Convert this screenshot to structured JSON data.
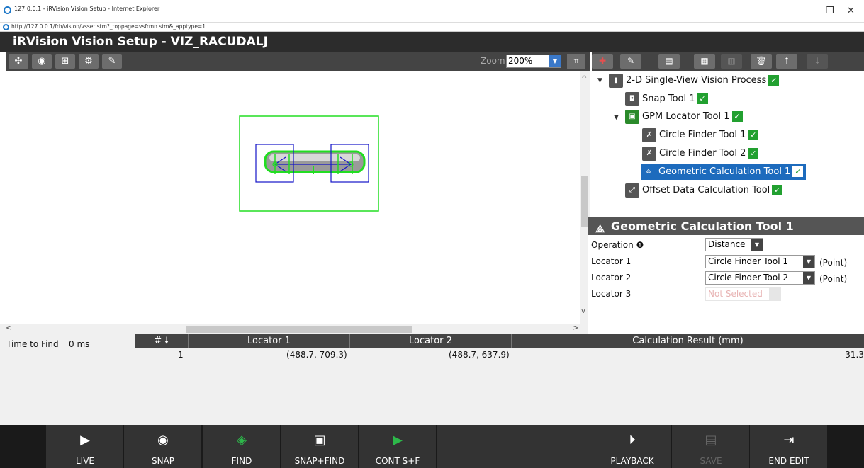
{
  "browser": {
    "title": "127.0.0.1 - iRVision Vision Setup - Internet Explorer",
    "url": "http://127.0.0.1/frh/vision/vsset.stm?_toppage=vsfrmn.stm&_apptype=1",
    "minimize": "–",
    "restore": "❐",
    "close": "✕"
  },
  "app": {
    "title": "iRVision Vision Setup - VIZ_RACUDALJ"
  },
  "image_toolbar": {
    "zoom_label": "Zoom",
    "zoom_value": "200%",
    "buttons": [
      "pointer-icon",
      "camera-icon",
      "grid-icon",
      "settings-icon",
      "pencil-icon"
    ]
  },
  "tree_toolbar": {
    "buttons": [
      "add-icon",
      "edit-icon",
      "insert-icon",
      "copy-icon",
      "paste-icon",
      "delete-icon",
      "move-up-icon",
      "move-down-icon"
    ],
    "up_arrow": "↑",
    "down_arrow": "↓",
    "delete_glyph": "🗑"
  },
  "tree": {
    "items": [
      {
        "label": "2-D Single-View Vision Process",
        "icon": "vision-process-icon"
      },
      {
        "label": "Snap Tool 1",
        "icon": "snap-icon"
      },
      {
        "label": "GPM Locator Tool 1",
        "icon": "gpm-locator-icon"
      },
      {
        "label": "Circle Finder Tool 1",
        "icon": "circle-finder-icon"
      },
      {
        "label": "Circle Finder Tool 2",
        "icon": "circle-finder-icon"
      },
      {
        "label": "Geometric Calculation Tool 1",
        "icon": "geometric-calc-icon",
        "selected": true
      },
      {
        "label": "Offset Data Calculation Tool",
        "icon": "offset-calc-icon"
      }
    ]
  },
  "properties": {
    "title": "Geometric Calculation Tool 1",
    "operation_label": "Operation",
    "operation_value": "Distance",
    "locator1_label": "Locator 1",
    "locator1_value": "Circle Finder Tool 1",
    "locator1_suffix": "(Point)",
    "locator2_label": "Locator 2",
    "locator2_value": "Circle Finder Tool 2",
    "locator2_suffix": "(Point)",
    "locator3_label": "Locator 3",
    "locator3_value": "Not Selected"
  },
  "results": {
    "time_label": "Time to Find",
    "time_value": "0 ms",
    "columns": [
      "#",
      "Locator 1",
      "Locator 2",
      "Calculation Result (mm)"
    ],
    "rows": [
      {
        "num": "1",
        "loc1": "(488.7, 709.3)",
        "loc2": "(488.7, 637.9)",
        "result": "31.3"
      }
    ]
  },
  "bottom_bar": {
    "buttons": [
      {
        "label": "LIVE",
        "enabled": true
      },
      {
        "label": "SNAP",
        "enabled": true
      },
      {
        "label": "FIND",
        "enabled": true
      },
      {
        "label": "SNAP+FIND",
        "enabled": true
      },
      {
        "label": "CONT S+F",
        "enabled": true
      },
      {
        "label": "",
        "enabled": false
      },
      {
        "label": "",
        "enabled": false
      },
      {
        "label": "PLAYBACK",
        "enabled": true
      },
      {
        "label": "SAVE",
        "enabled": false
      },
      {
        "label": "END EDIT",
        "enabled": true
      }
    ]
  },
  "colors": {
    "header_bg": "#2c2c2c",
    "selected_bg": "#1d6bbd",
    "check_green": "#22a030",
    "locator_green": "#22dd22",
    "locator_blue": "#1515c8"
  }
}
